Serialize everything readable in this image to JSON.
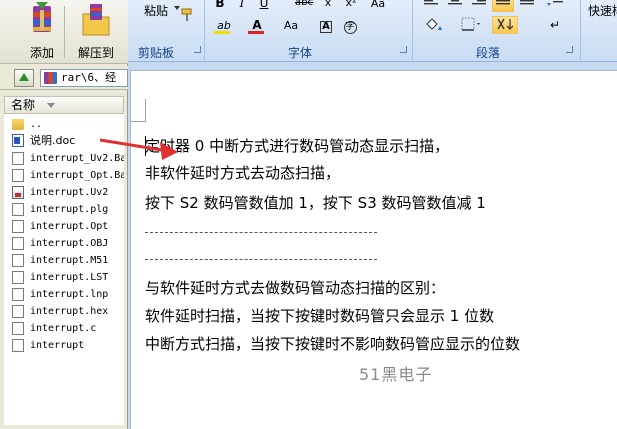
{
  "winrar": {
    "toolbar": {
      "add_label": "添加",
      "extract_label": "解压到"
    },
    "path_text": "rar\\6、经",
    "column_header": "名称",
    "files": [
      {
        "name": "..",
        "icon": "folder-icon"
      },
      {
        "name": "说明.doc",
        "icon": "word-doc-icon"
      },
      {
        "name": "interrupt_Uv2.Ba",
        "icon": "file-icon"
      },
      {
        "name": "interrupt_Opt.Ba",
        "icon": "file-icon"
      },
      {
        "name": "interrupt.Uv2",
        "icon": "uv2-project-icon"
      },
      {
        "name": "interrupt.plg",
        "icon": "file-icon"
      },
      {
        "name": "interrupt.Opt",
        "icon": "file-icon"
      },
      {
        "name": "interrupt.OBJ",
        "icon": "file-icon"
      },
      {
        "name": "interrupt.M51",
        "icon": "file-icon"
      },
      {
        "name": "interrupt.LST",
        "icon": "file-icon"
      },
      {
        "name": "interrupt.lnp",
        "icon": "file-icon"
      },
      {
        "name": "interrupt.hex",
        "icon": "file-icon"
      },
      {
        "name": "interrupt.c",
        "icon": "file-icon"
      },
      {
        "name": "interrupt",
        "icon": "file-icon"
      }
    ]
  },
  "word": {
    "ribbon": {
      "paste_label": "粘贴",
      "quick_style_label": "快速样",
      "group_clipboard": "剪贴板",
      "group_font": "字体",
      "group_paragraph": "段落",
      "font_buttons": {
        "bold": "B",
        "italic": "I",
        "underline": "U",
        "strike": "abc",
        "subscript": "x",
        "superscript": "x²",
        "font_grow": "Aa",
        "font_color": "A",
        "highlight": "ab"
      }
    },
    "document": {
      "lines": [
        "定时器 0 中断方式进行数码管动态显示扫描，",
        "非软件延时方式去动态扫描，",
        "按下 S2 数码管数值加 1，按下 S3 数码管数值减 1",
        "与软件延时方式去做数码管动态扫描的区别：",
        "软件延时扫描，当按下按键时数码管只会显示 1 位数",
        "中断方式扫描，当按下按键时不影响数码管应显示的位数"
      ],
      "watermark": "51黑电子"
    }
  },
  "colors": {
    "annotation_arrow": "#e03030",
    "ribbon_text": "#15428b",
    "font_color_underline": "#e0202a",
    "highlight_underline": "#f0e000"
  }
}
